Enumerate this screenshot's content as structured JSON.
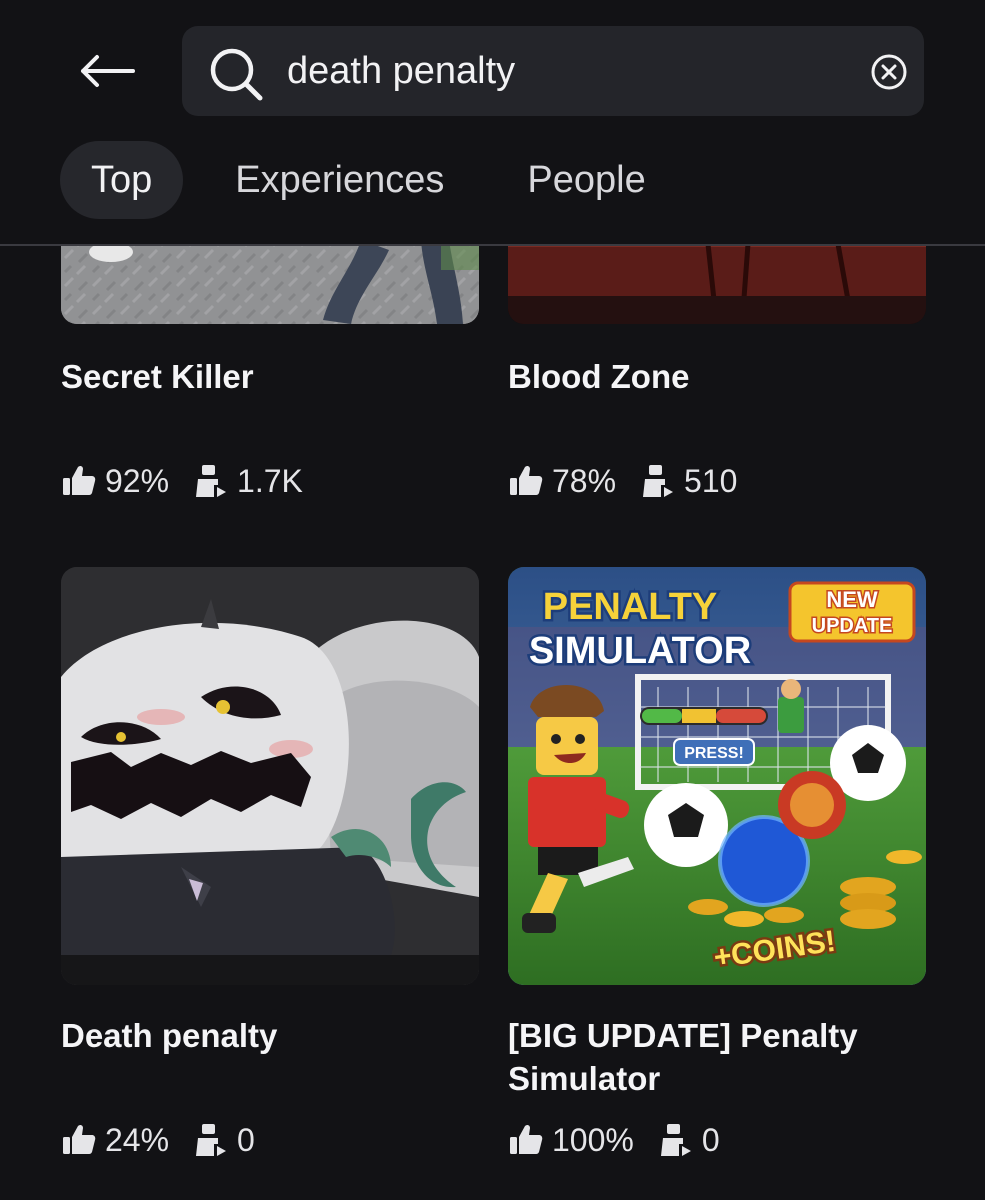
{
  "search": {
    "query": "death penalty",
    "back_icon": "arrow-left-icon",
    "search_icon": "search-icon",
    "clear_icon": "close-circle-icon"
  },
  "tabs": [
    {
      "label": "Top",
      "active": true
    },
    {
      "label": "Experiences",
      "active": false
    },
    {
      "label": "People",
      "active": false
    }
  ],
  "results": [
    {
      "title": "Secret Killer",
      "rating": "92%",
      "players": "1.7K"
    },
    {
      "title": "Blood Zone",
      "rating": "78%",
      "players": "510"
    },
    {
      "title": "Death penalty",
      "rating": "24%",
      "players": "0"
    },
    {
      "title": "[BIG UPDATE] Penalty Simulator",
      "rating": "100%",
      "players": "0",
      "thumbnail_text": {
        "logo_line1": "PENALTY",
        "logo_line2": "SIMULATOR",
        "badge_line1": "NEW",
        "badge_line2": "UPDATE",
        "press_label": "PRESS!",
        "coins_label": "+COINS!"
      }
    }
  ],
  "colors": {
    "background": "#121215",
    "search_field": "#24252a",
    "active_tab": "#26272c"
  }
}
